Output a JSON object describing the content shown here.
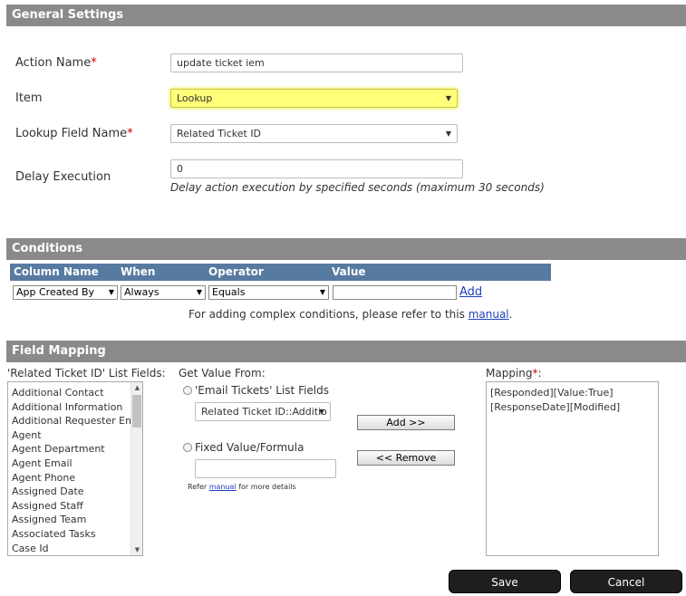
{
  "general": {
    "title": "General Settings",
    "action_name_label": "Action Name",
    "action_name_value": "update ticket iem",
    "item_label": "Item",
    "item_value": "Lookup",
    "lookup_field_label": "Lookup Field Name",
    "lookup_field_value": "Related Ticket ID",
    "delay_label": "Delay Execution",
    "delay_value": "0",
    "delay_hint": "Delay action execution by specified seconds (maximum 30 seconds)",
    "required_mark": "*"
  },
  "conditions": {
    "title": "Conditions",
    "headers": [
      "Column Name",
      "When",
      "Operator",
      "Value"
    ],
    "column_value": "App Created By",
    "when_value": "Always",
    "operator_value": "Equals",
    "value_value": "",
    "add_link": "Add",
    "note_prefix": "For adding complex conditions, please refer to this",
    "note_link": "manual",
    "note_suffix": "."
  },
  "mapping": {
    "title": "Field Mapping",
    "list_label": "'Related Ticket ID' List Fields:",
    "list_items": [
      "Additional Contact",
      "Additional Information",
      "Additional Requester Email",
      "Agent",
      "Agent Department",
      "Agent Email",
      "Agent Phone",
      "Assigned Date",
      "Assigned Staff",
      "Assigned Team",
      "Associated Tasks",
      "Case Id"
    ],
    "get_value_label": "Get Value From:",
    "option_list_label": "'Email Tickets' List Fields",
    "option_list_value": "Related Ticket ID::Additio",
    "option_fixed_label": "Fixed Value/Formula",
    "fixed_value": "",
    "refer_prefix": "Refer",
    "refer_link": "manual",
    "refer_suffix": "for more details",
    "add_button": "Add >>",
    "remove_button": "<< Remove",
    "mapping_label": "Mapping",
    "mapping_items": [
      "[Responded][Value:True]",
      "[ResponseDate][Modified]"
    ]
  },
  "footer": {
    "save": "Save",
    "cancel": "Cancel"
  }
}
